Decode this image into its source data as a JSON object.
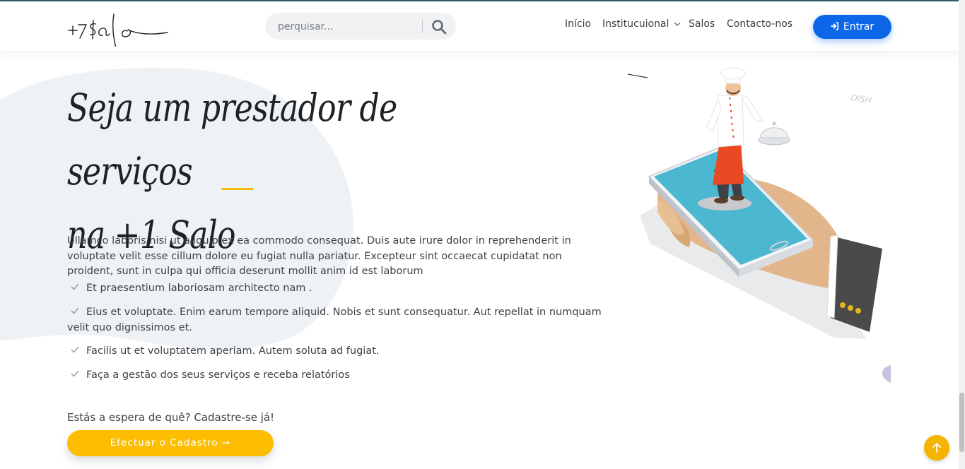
{
  "header": {
    "logo_text": "+1$alo",
    "search": {
      "placeholder": "perquisar..."
    },
    "nav": [
      {
        "label": "Início"
      },
      {
        "label": "Institucuional"
      },
      {
        "label": "Salos"
      },
      {
        "label": "Contacto-nos"
      }
    ],
    "login_label": "Entrar"
  },
  "hero": {
    "title_line1": "Seja um prestador de serviços",
    "title_line2": "na +1 Salo",
    "intro": "Ullamco laboris nisi ut aliquip ex ea commodo consequat. Duis aute irure dolor in reprehenderit in voluptate velit esse cillum dolore eu fugiat nulla pariatur. Excepteur sint occaecat cupidatat non proident, sunt in culpa qui officia deserunt mollit anim id est laborum",
    "checks": [
      "Et praesentium laboriosam architecto nam .",
      "Eius et voluptate. Enim earum tempore aliquid. Nobis et sunt consequatur. Aut repellat in numquam velit quo dignissimos et.",
      "Facilis ut et voluptatem aperiam. Autem soluta ad fugiat.",
      "Faça a gestão dos seus serviços e receba relatórios"
    ],
    "cta_prompt": "Estás a espera de quê? Cadastre-se já!",
    "cta_label": "Efectuar o Cadastro →"
  },
  "illustration": {
    "dish_label": "DISH"
  },
  "colors": {
    "primary": "#0c67e8",
    "accent": "#fdbd00",
    "blob": "#eff2f5",
    "text": "#3d4148"
  },
  "icons": {
    "search": "search-icon",
    "login": "sign-in-icon",
    "check": "check-icon",
    "to_top": "arrow-up-icon",
    "dropdown": "chevron-down-icon"
  }
}
